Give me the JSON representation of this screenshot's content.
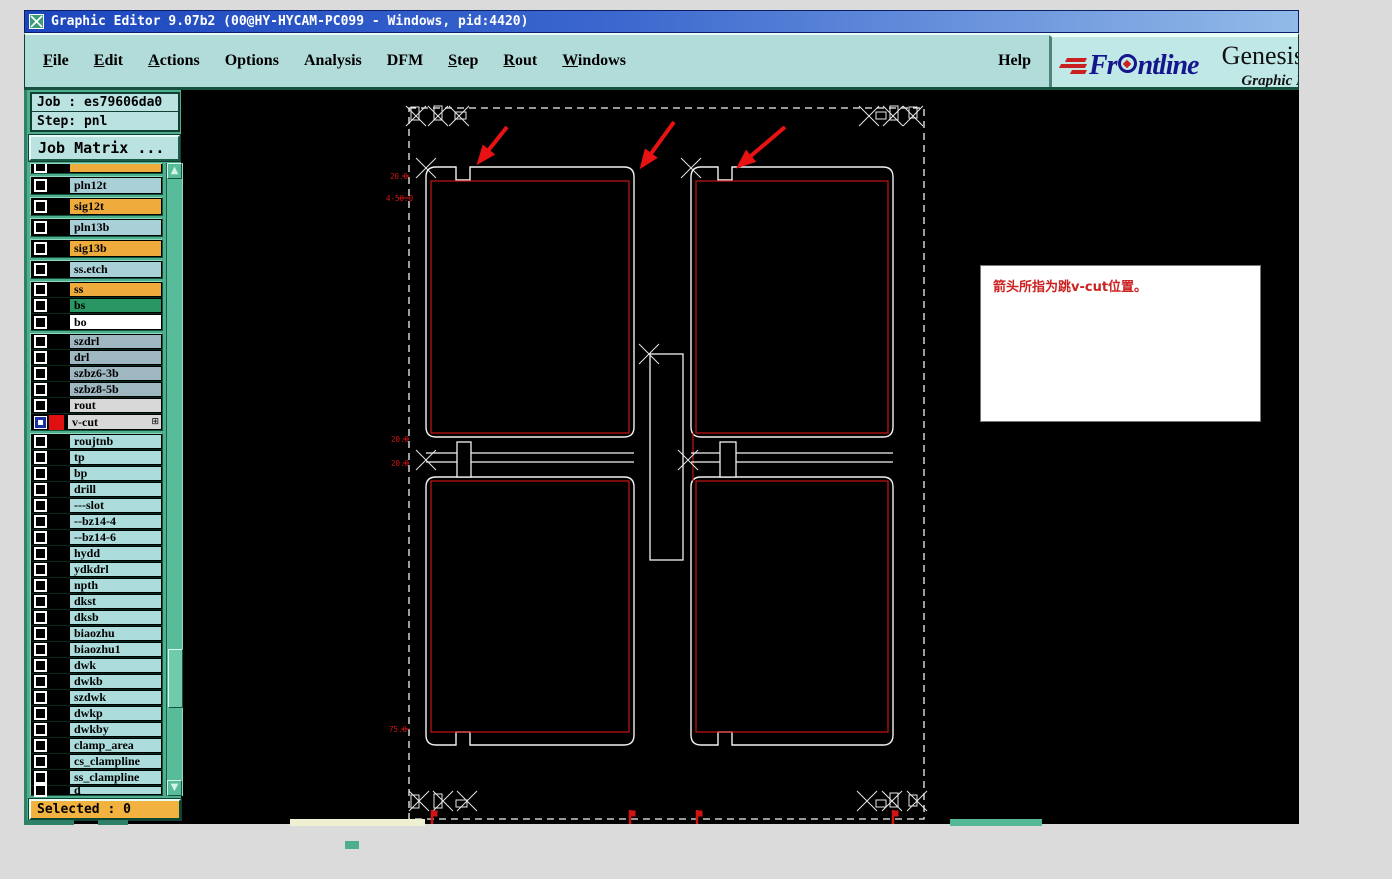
{
  "window": {
    "title": "Graphic Editor 9.07b2 (00@HY-HYCAM-PC099 - Windows, pid:4420)"
  },
  "menu_bar": {
    "items": [
      {
        "label": "File",
        "underline": 0
      },
      {
        "label": "Edit",
        "underline": 0
      },
      {
        "label": "Actions",
        "underline": 0
      },
      {
        "label": "Options",
        "underline": -1
      },
      {
        "label": "Analysis",
        "underline": -1
      },
      {
        "label": "DFM",
        "underline": -1
      },
      {
        "label": "Step",
        "underline": 0
      },
      {
        "label": "Rout",
        "underline": 0
      },
      {
        "label": "Windows",
        "underline": 0
      }
    ],
    "help_label": "Help"
  },
  "logo": {
    "brand_prefix": "Fr",
    "brand_suffix": "ntline",
    "product": "Genesis",
    "subtitle": "Graphic E"
  },
  "sidebar": {
    "job_label": "Job : es79606da0",
    "step_label": "Step: pnl",
    "job_matrix_button": "Job Matrix ...",
    "selected_label": "Selected : 0",
    "layer_groups": [
      {
        "kind": "partial",
        "rows": [
          {
            "name": "",
            "color": "#EFAC3D"
          }
        ]
      },
      {
        "kind": "box",
        "tall": true,
        "rows": [
          {
            "name": "pln12t",
            "color": "#A9CFD7"
          }
        ]
      },
      {
        "kind": "box",
        "tall": true,
        "rows": [
          {
            "name": "sig12t",
            "color": "#EFAC3D"
          }
        ]
      },
      {
        "kind": "box",
        "tall": true,
        "rows": [
          {
            "name": "pln13b",
            "color": "#A9CFD7"
          }
        ]
      },
      {
        "kind": "box",
        "tall": true,
        "rows": [
          {
            "name": "sig13b",
            "color": "#EFAC3D"
          }
        ]
      },
      {
        "kind": "box",
        "tall": true,
        "rows": [
          {
            "name": "ss.etch",
            "color": "#A9CFD7"
          }
        ]
      },
      {
        "kind": "box",
        "rows": [
          {
            "name": "ss",
            "color": "#EFAC3D"
          },
          {
            "name": "bs",
            "color": "#2A9663"
          },
          {
            "name": "bo",
            "color": "#FFFFFF"
          }
        ]
      },
      {
        "kind": "box",
        "rows": [
          {
            "name": "szdrl",
            "color": "#9EB7C0"
          },
          {
            "name": "drl",
            "color": "#9EB7C0"
          },
          {
            "name": "szbz6-3b",
            "color": "#9EB7C0"
          },
          {
            "name": "szbz8-5b",
            "color": "#9EB7C0"
          },
          {
            "name": "rout",
            "color": "#D8D8D8"
          },
          {
            "name": "v-cut",
            "color": "#D8D8D8",
            "vcut": true,
            "swatch": "#E01010",
            "grid_icon": "⊞"
          }
        ]
      },
      {
        "kind": "box",
        "rows": [
          {
            "name": "roujtnb",
            "color": "#ACDCDB"
          },
          {
            "name": "tp",
            "color": "#ACDCDB"
          },
          {
            "name": "bp",
            "color": "#ACDCDB"
          },
          {
            "name": "drill",
            "color": "#ACDCDB"
          },
          {
            "name": "---slot",
            "color": "#ACDCDB"
          },
          {
            "name": "--bz14-4",
            "color": "#ACDCDB"
          },
          {
            "name": "--bz14-6",
            "color": "#ACDCDB"
          },
          {
            "name": "hydd",
            "color": "#ACDCDB"
          },
          {
            "name": "ydkdrl",
            "color": "#ACDCDB"
          },
          {
            "name": "npth",
            "color": "#ACDCDB"
          },
          {
            "name": "dkst",
            "color": "#ACDCDB"
          },
          {
            "name": "dksb",
            "color": "#ACDCDB"
          },
          {
            "name": "biaozhu",
            "color": "#ACDCDB"
          },
          {
            "name": "biaozhu1",
            "color": "#ACDCDB"
          },
          {
            "name": "dwk",
            "color": "#ACDCDB"
          },
          {
            "name": "dwkb",
            "color": "#ACDCDB"
          },
          {
            "name": "szdwk",
            "color": "#ACDCDB"
          },
          {
            "name": "dwkp",
            "color": "#ACDCDB"
          },
          {
            "name": "dwkby",
            "color": "#ACDCDB"
          },
          {
            "name": "clamp_area",
            "color": "#ACDCDB"
          },
          {
            "name": "cs_clampline",
            "color": "#ACDCDB"
          },
          {
            "name": "ss_clampline",
            "color": "#ACDCDB"
          },
          {
            "name": "d",
            "color": "#ACDCDB",
            "clipped": true
          }
        ]
      }
    ]
  },
  "canvas": {
    "note_text": "箭头所指为跳v-cut位置。",
    "dim_labels": [
      "20.0",
      "4-50.0",
      "20.0",
      "20.0",
      "75.0"
    ],
    "colors": {
      "outline_white": "#F2F2F2",
      "cad_red": "#C41414",
      "arrow_red": "#E81212"
    }
  },
  "ui_colors": {
    "title_blue": "#1C46BE",
    "menubar_teal": "#B2DCDA",
    "sidebar_teal": "#4FAE8C",
    "status_orange": "#F2B240",
    "brand_navy": "#16168C",
    "brand_red": "#CC2020"
  }
}
